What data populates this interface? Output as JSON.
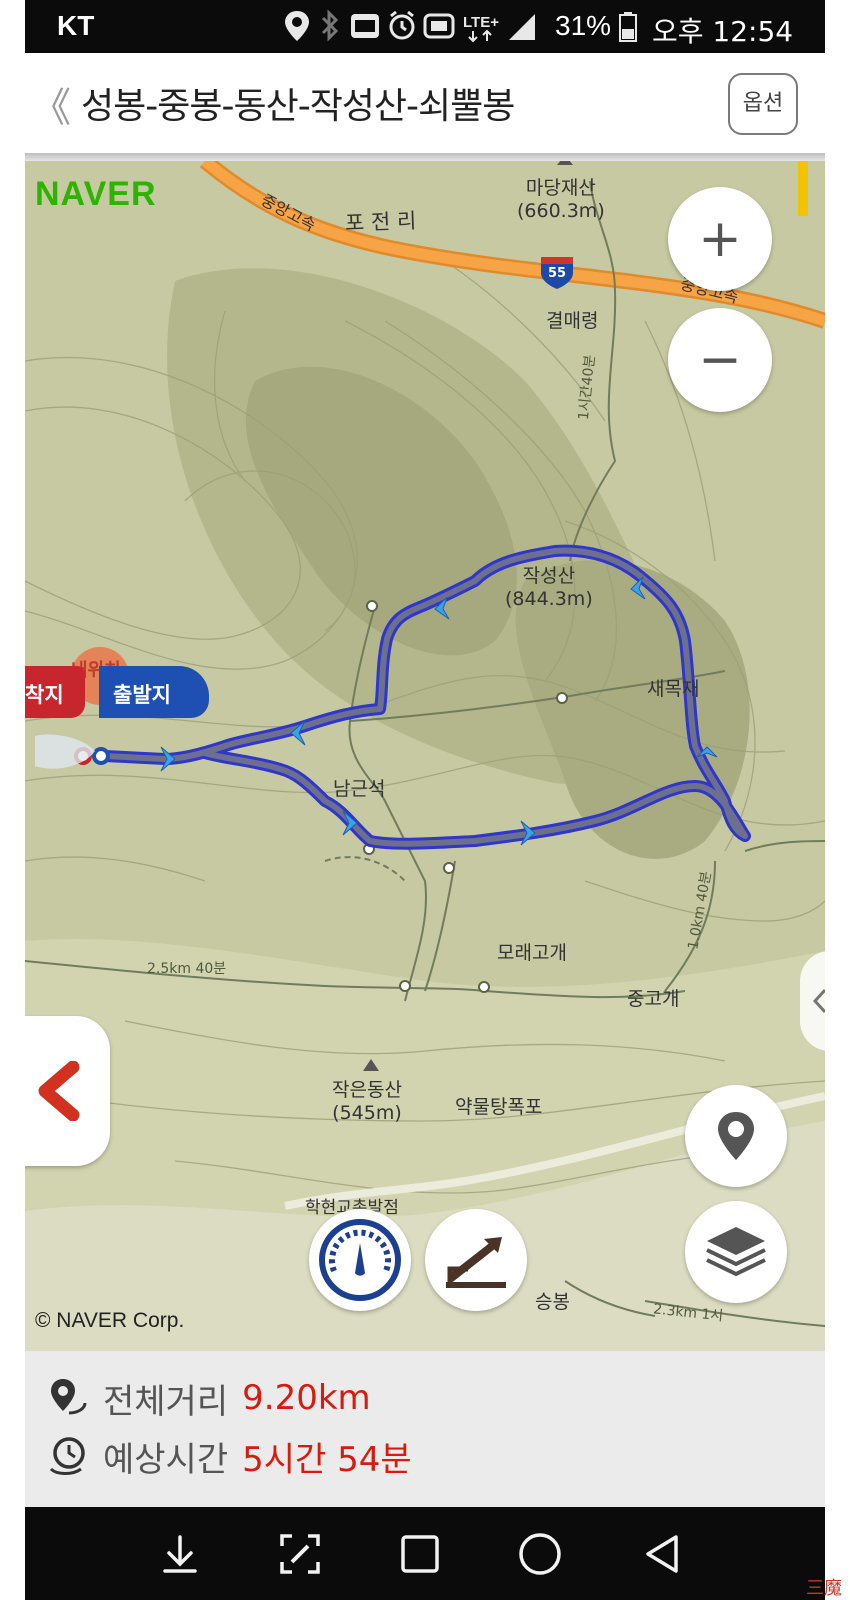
{
  "status_bar": {
    "carrier": "KT",
    "battery_percent": "31%",
    "time": "오후 12:54",
    "lte_label": "LTE+",
    "icons": [
      "location-icon",
      "bluetooth-icon",
      "nfc-icon",
      "alarm-icon",
      "hd-icon",
      "lte-icon",
      "signal-icon",
      "battery-icon"
    ]
  },
  "header": {
    "back_glyph": "《",
    "title": "성봉-중봉-동산-작성산-쇠뿔봉",
    "option_label": "옵션"
  },
  "map": {
    "provider_logo": "NAVER",
    "copyright": "© NAVER Corp.",
    "labels": {
      "madang": "마당재산",
      "madang_elev": "(660.3m)",
      "pojeonri": "포 전 리",
      "highway_left": "중앙고속",
      "highway_right": "중앙고속",
      "highway_shield": "55",
      "gyeolmae": "결매령",
      "jakseong": "작성산",
      "jakseong_elev": "(844.3m)",
      "saemok": "새목재",
      "namgeun": "남근석",
      "morae": "모래고개",
      "junggo": "중고개",
      "jageun": "작은동산",
      "jageun_elev": "(545m)",
      "yakmul": "약물탕폭포",
      "hakhyeon": "학현교촌발점",
      "seungbong": "승봉",
      "trail_1": "1시간40분",
      "trail_2": "2.5km 40분",
      "trail_3": "1.0km 40분",
      "trail_4": "2.3km 1시",
      "current_loc": "내위치"
    },
    "flags": {
      "arrival": "착지",
      "departure": "출발지"
    },
    "route_color": "#2f36c9",
    "route_fill": "#6d6f8e",
    "zoom_in": "+",
    "zoom_out": "−",
    "buttons": [
      "zoom-in-button",
      "zoom-out-button",
      "my-location-button",
      "layers-button",
      "speed-gauge-button",
      "elevation-profile-button"
    ]
  },
  "info": {
    "distance_label": "전체거리",
    "distance_value": "9.20km",
    "time_label": "예상시간",
    "time_value": "5시간 54분",
    "value_color": "#d81b0f"
  },
  "navbar": {
    "buttons": [
      "download-icon",
      "edit-screenshot-icon",
      "recent-apps-icon",
      "home-icon",
      "back-icon"
    ]
  },
  "watermark": "三魔"
}
